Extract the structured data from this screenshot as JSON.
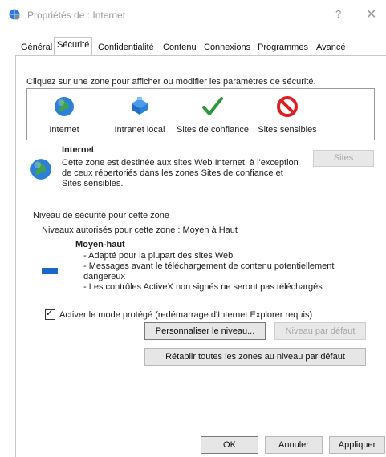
{
  "window": {
    "title": "Propriétés de : Internet",
    "help_label": "?",
    "close_label": "✕"
  },
  "tabs": [
    {
      "label": "Général"
    },
    {
      "label": "Sécurité"
    },
    {
      "label": "Confidentialité"
    },
    {
      "label": "Contenu"
    },
    {
      "label": "Connexions"
    },
    {
      "label": "Programmes"
    },
    {
      "label": "Avancé"
    }
  ],
  "active_tab": "Sécurité",
  "zones": {
    "instruction": "Cliquez sur une zone pour afficher ou modifier les paramètres de sécurité.",
    "items": [
      {
        "label": "Internet",
        "icon": "globe-icon"
      },
      {
        "label": "Intranet local",
        "icon": "network-icon"
      },
      {
        "label": "Sites de confiance",
        "icon": "checkmark-icon"
      },
      {
        "label": "Sites sensibles",
        "icon": "blocked-icon"
      }
    ],
    "selected": "Internet"
  },
  "zone_info": {
    "title": "Internet",
    "description": "Cette zone est destinée aux sites Web Internet, à l'exception de ceux répertoriés dans les zones Sites de confiance et Sites sensibles.",
    "sites_button": "Sites"
  },
  "security_level": {
    "title": "Niveau de sécurité pour cette zone",
    "allowed": "Niveaux autorisés pour cette zone : Moyen à Haut",
    "level_name": "Moyen-haut",
    "bullets": [
      "- Adapté pour la plupart des sites Web",
      "- Messages avant le téléchargement de contenu potentiellement dangereux",
      "- Les contrôles ActiveX non signés ne seront pas téléchargés"
    ]
  },
  "protected_mode": {
    "label": "Activer le mode protégé (redémarrage d'Internet Explorer requis)",
    "checked": true
  },
  "buttons": {
    "customize": "Personnaliser le niveau...",
    "default_level": "Niveau par défaut",
    "reset_all": "Rétablir toutes les zones au niveau par défaut",
    "ok": "OK",
    "cancel": "Annuler",
    "apply": "Appliquer"
  },
  "colors": {
    "accent": "#1b66c9",
    "disabled_text": "#a8a8a8"
  }
}
